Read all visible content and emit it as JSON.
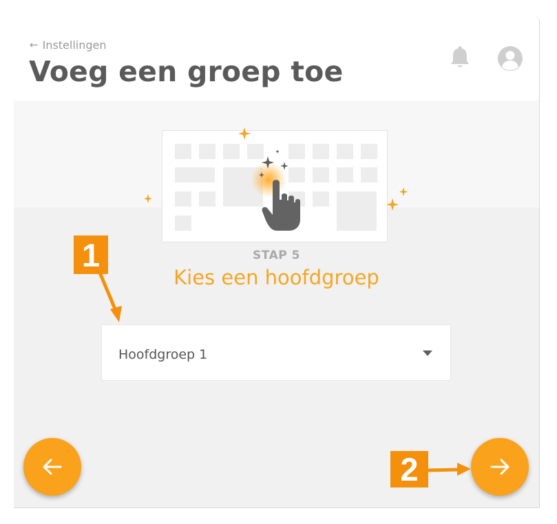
{
  "header": {
    "back_label": "Instellingen",
    "title": "Voeg een groep toe",
    "icons": [
      "bell-icon",
      "account-icon"
    ]
  },
  "step": {
    "label": "STAP 5",
    "title": "Kies een hoofdgroep"
  },
  "select": {
    "value": "Hoofdgroep 1"
  },
  "navigation": {
    "prev_icon": "arrow-left-icon",
    "next_icon": "arrow-right-icon"
  },
  "annotations": {
    "callout_1": "1",
    "callout_2": "2"
  },
  "colors": {
    "accent": "#faa21b",
    "title_orange": "#f5a623",
    "callout_orange": "#f5900c",
    "title_gray": "#5a5a5a"
  }
}
